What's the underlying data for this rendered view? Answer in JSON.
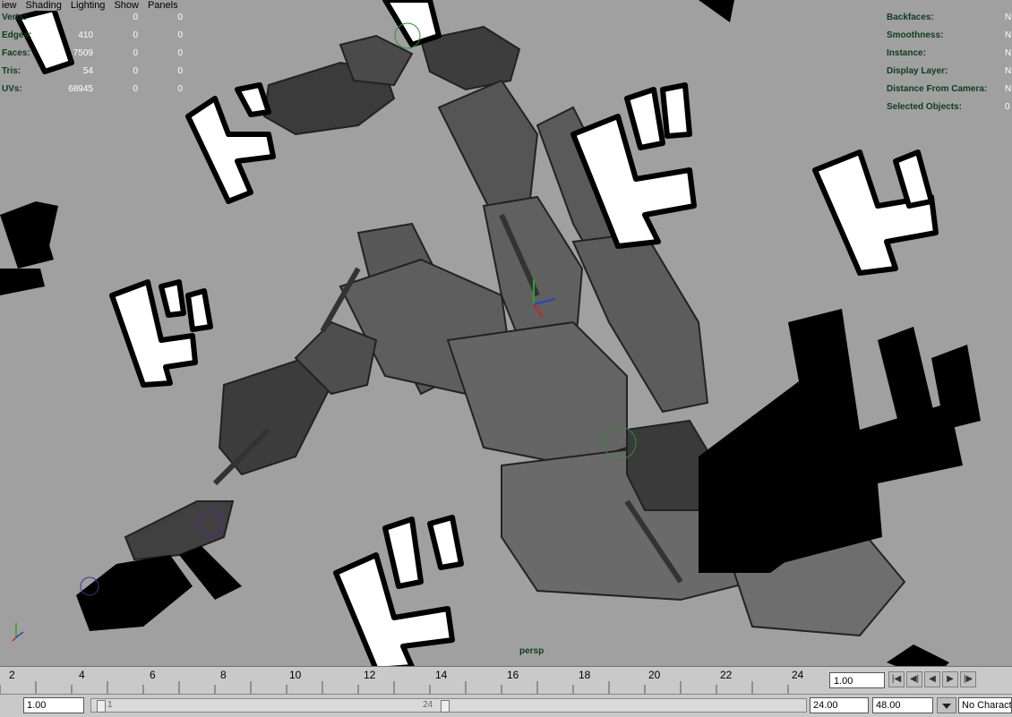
{
  "menubar": {
    "items": [
      "iew",
      "Shading",
      "Lighting",
      "Show",
      "Panels"
    ]
  },
  "hud_left": {
    "rows": [
      {
        "label": "Verts:",
        "v1": "",
        "v2": "0",
        "v3": "0"
      },
      {
        "label": "Edges:",
        "v1": "410",
        "v2": "0",
        "v3": "0"
      },
      {
        "label": "Faces:",
        "v1": "7509",
        "v2": "0",
        "v3": "0"
      },
      {
        "label": "Tris:",
        "v1": "54",
        "v2": "0",
        "v3": "0"
      },
      {
        "label": "UVs:",
        "v1": "68945",
        "v2": "0",
        "v3": "0"
      }
    ]
  },
  "hud_right": {
    "rows": [
      {
        "label": "Backfaces:",
        "value": "N"
      },
      {
        "label": "Smoothness:",
        "value": "N"
      },
      {
        "label": "Instance:",
        "value": "N"
      },
      {
        "label": "Display Layer:",
        "value": "N"
      },
      {
        "label": "Distance From Camera:",
        "value": "N"
      },
      {
        "label": "Selected Objects:",
        "value": "0"
      }
    ]
  },
  "camera": {
    "name": "persp"
  },
  "timeline": {
    "tick_labels": [
      "2",
      "4",
      "6",
      "8",
      "10",
      "12",
      "14",
      "16",
      "18",
      "20",
      "22",
      "24"
    ],
    "current_frame": "1.00"
  },
  "range": {
    "start": "1.00",
    "slider_start": "1",
    "slider_end": "24",
    "end": "24.00",
    "anim_end": "48.00",
    "character": "No Character"
  },
  "colors": {
    "viewport_bg": "#a0a0a0",
    "hud_label": "#0c3d1c",
    "hud_value": "#ffffff"
  }
}
